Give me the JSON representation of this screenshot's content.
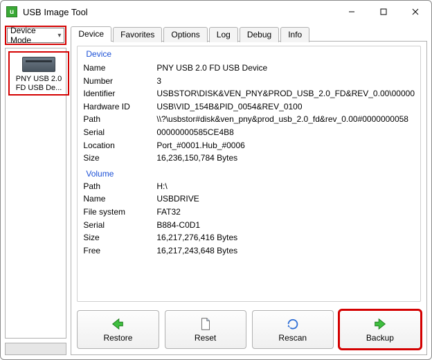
{
  "window": {
    "title": "USB Image Tool"
  },
  "mode": {
    "selected": "Device Mode"
  },
  "device_list": {
    "items": [
      {
        "label_line1": "PNY USB 2.0",
        "label_line2": "FD USB De..."
      }
    ]
  },
  "tabs": {
    "items": [
      "Device",
      "Favorites",
      "Options",
      "Log",
      "Debug",
      "Info"
    ],
    "active_index": 0
  },
  "device_group": {
    "title": "Device",
    "rows": [
      {
        "k": "Name",
        "v": "PNY USB 2.0 FD USB Device"
      },
      {
        "k": "Number",
        "v": "3"
      },
      {
        "k": "Identifier",
        "v": "USBSTOR\\DISK&VEN_PNY&PROD_USB_2.0_FD&REV_0.00\\00000"
      },
      {
        "k": "Hardware ID",
        "v": "USB\\VID_154B&PID_0054&REV_0100"
      },
      {
        "k": "Path",
        "v": "\\\\?\\usbstor#disk&ven_pny&prod_usb_2.0_fd&rev_0.00#0000000058"
      },
      {
        "k": "Serial",
        "v": "00000000585CE4B8"
      },
      {
        "k": "Location",
        "v": "Port_#0001.Hub_#0006"
      },
      {
        "k": "Size",
        "v": "16,236,150,784 Bytes"
      }
    ]
  },
  "volume_group": {
    "title": "Volume",
    "rows": [
      {
        "k": "Path",
        "v": "H:\\"
      },
      {
        "k": "Name",
        "v": "USBDRIVE"
      },
      {
        "k": "File system",
        "v": "FAT32"
      },
      {
        "k": "Serial",
        "v": "B884-C0D1"
      },
      {
        "k": "Size",
        "v": "16,217,276,416 Bytes"
      },
      {
        "k": "Free",
        "v": "16,217,243,648 Bytes"
      }
    ]
  },
  "buttons": {
    "restore": "Restore",
    "reset": "Reset",
    "rescan": "Rescan",
    "backup": "Backup"
  }
}
